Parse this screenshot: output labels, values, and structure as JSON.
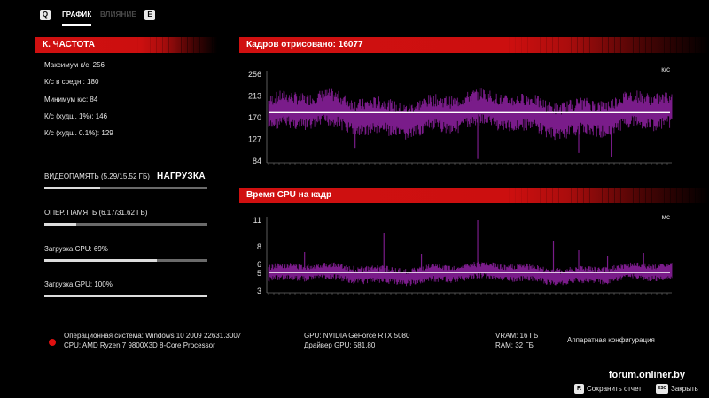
{
  "tabs": {
    "prev_key": "Q",
    "next_key": "E",
    "items": [
      {
        "label": "ГРАФИК",
        "active": true
      },
      {
        "label": "ВЛИЯНИЕ",
        "active": false
      }
    ]
  },
  "fps_panel": {
    "header": "К. ЧАСТОТА",
    "stats": [
      "Максимум к/с: 256",
      "К/с в средн.: 180",
      "Минимум к/с: 84",
      "К/с (худш. 1%): 146",
      "К/с (худш. 0.1%): 129"
    ]
  },
  "load_panel": {
    "title": "НАГРУЗКА",
    "meters": [
      {
        "label": "ВИДЕОПАМЯТЬ (5.29/15.52 ГБ)",
        "fraction": 0.34
      },
      {
        "label": "ОПЕР. ПАМЯТЬ (6.17/31.62 ГБ)",
        "fraction": 0.195
      },
      {
        "label": "Загрузка CPU: 69%",
        "fraction": 0.69
      },
      {
        "label": "Загрузка GPU: 100%",
        "fraction": 1.0
      }
    ]
  },
  "fps_chart": {
    "header": "Кадров отрисовано: 16077",
    "unit": "к/с",
    "ticks": [
      "256",
      "213",
      "170",
      "127",
      "84"
    ],
    "ymin": 84,
    "ymax": 256,
    "avg": 180,
    "baseline": 178,
    "spread": 28,
    "samples": 560,
    "seed": 7,
    "spikes": [
      [
        290,
        88
      ],
      [
        430,
        100
      ],
      [
        475,
        92
      ],
      [
        120,
        110
      ]
    ]
  },
  "cpu_chart": {
    "header": "Время CPU на кадр",
    "unit": "мс",
    "ticks": [
      "11",
      "8",
      "6",
      "5",
      "3"
    ],
    "tick_values": [
      11,
      8,
      6,
      5,
      3
    ],
    "ymin": 3,
    "ymax": 11,
    "avg": 5.1,
    "baseline": 5.0,
    "spread": 0.75,
    "samples": 560,
    "seed": 13,
    "spikes": [
      [
        290,
        11
      ],
      [
        160,
        9.5
      ],
      [
        395,
        8.7
      ],
      [
        50,
        7.4
      ],
      [
        212,
        7.2
      ],
      [
        430,
        7.6
      ],
      [
        470,
        7.0
      ],
      [
        520,
        7.3
      ]
    ]
  },
  "system_info": {
    "os": "Операционная система: Windows 10 2009 22631.3007",
    "cpu": "CPU: AMD Ryzen 7 9800X3D 8-Core Processor",
    "gpu": "GPU: NVIDIA GeForce RTX 5080",
    "driver": "Драйвер GPU: 581.80",
    "vram": "VRAM: 16 ГБ",
    "ram": "RAM: 32 ГБ",
    "hardware_config": "Аппаратная конфигурация"
  },
  "footer": {
    "brand": "forum.onliner.by",
    "save_key": "R",
    "save_label": "Сохранить отчет",
    "close_key": "ESC",
    "close_label": "Закрыть"
  },
  "colors": {
    "accent_red": "#d01010",
    "graph_purple": "#7a1c8a",
    "avg_line": "#ffffff"
  }
}
